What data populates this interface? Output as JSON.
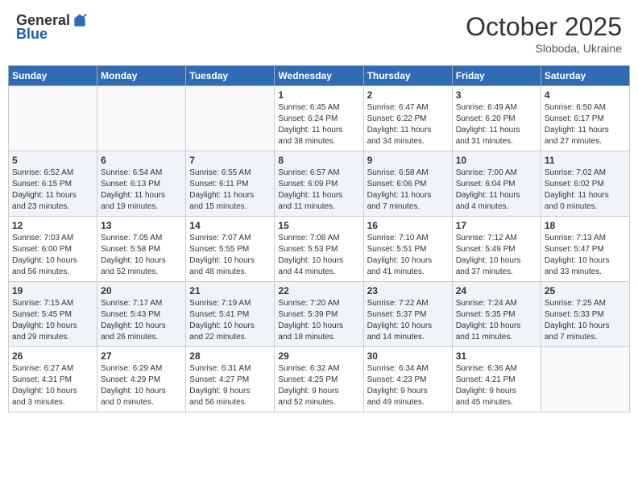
{
  "header": {
    "logo_general": "General",
    "logo_blue": "Blue",
    "month_year": "October 2025",
    "location": "Sloboda, Ukraine"
  },
  "weekdays": [
    "Sunday",
    "Monday",
    "Tuesday",
    "Wednesday",
    "Thursday",
    "Friday",
    "Saturday"
  ],
  "weeks": [
    [
      {
        "day": "",
        "info": ""
      },
      {
        "day": "",
        "info": ""
      },
      {
        "day": "",
        "info": ""
      },
      {
        "day": "1",
        "info": "Sunrise: 6:45 AM\nSunset: 6:24 PM\nDaylight: 11 hours\nand 38 minutes."
      },
      {
        "day": "2",
        "info": "Sunrise: 6:47 AM\nSunset: 6:22 PM\nDaylight: 11 hours\nand 34 minutes."
      },
      {
        "day": "3",
        "info": "Sunrise: 6:49 AM\nSunset: 6:20 PM\nDaylight: 11 hours\nand 31 minutes."
      },
      {
        "day": "4",
        "info": "Sunrise: 6:50 AM\nSunset: 6:17 PM\nDaylight: 11 hours\nand 27 minutes."
      }
    ],
    [
      {
        "day": "5",
        "info": "Sunrise: 6:52 AM\nSunset: 6:15 PM\nDaylight: 11 hours\nand 23 minutes."
      },
      {
        "day": "6",
        "info": "Sunrise: 6:54 AM\nSunset: 6:13 PM\nDaylight: 11 hours\nand 19 minutes."
      },
      {
        "day": "7",
        "info": "Sunrise: 6:55 AM\nSunset: 6:11 PM\nDaylight: 11 hours\nand 15 minutes."
      },
      {
        "day": "8",
        "info": "Sunrise: 6:57 AM\nSunset: 6:09 PM\nDaylight: 11 hours\nand 11 minutes."
      },
      {
        "day": "9",
        "info": "Sunrise: 6:58 AM\nSunset: 6:06 PM\nDaylight: 11 hours\nand 7 minutes."
      },
      {
        "day": "10",
        "info": "Sunrise: 7:00 AM\nSunset: 6:04 PM\nDaylight: 11 hours\nand 4 minutes."
      },
      {
        "day": "11",
        "info": "Sunrise: 7:02 AM\nSunset: 6:02 PM\nDaylight: 11 hours\nand 0 minutes."
      }
    ],
    [
      {
        "day": "12",
        "info": "Sunrise: 7:03 AM\nSunset: 6:00 PM\nDaylight: 10 hours\nand 56 minutes."
      },
      {
        "day": "13",
        "info": "Sunrise: 7:05 AM\nSunset: 5:58 PM\nDaylight: 10 hours\nand 52 minutes."
      },
      {
        "day": "14",
        "info": "Sunrise: 7:07 AM\nSunset: 5:55 PM\nDaylight: 10 hours\nand 48 minutes."
      },
      {
        "day": "15",
        "info": "Sunrise: 7:08 AM\nSunset: 5:53 PM\nDaylight: 10 hours\nand 44 minutes."
      },
      {
        "day": "16",
        "info": "Sunrise: 7:10 AM\nSunset: 5:51 PM\nDaylight: 10 hours\nand 41 minutes."
      },
      {
        "day": "17",
        "info": "Sunrise: 7:12 AM\nSunset: 5:49 PM\nDaylight: 10 hours\nand 37 minutes."
      },
      {
        "day": "18",
        "info": "Sunrise: 7:13 AM\nSunset: 5:47 PM\nDaylight: 10 hours\nand 33 minutes."
      }
    ],
    [
      {
        "day": "19",
        "info": "Sunrise: 7:15 AM\nSunset: 5:45 PM\nDaylight: 10 hours\nand 29 minutes."
      },
      {
        "day": "20",
        "info": "Sunrise: 7:17 AM\nSunset: 5:43 PM\nDaylight: 10 hours\nand 26 minutes."
      },
      {
        "day": "21",
        "info": "Sunrise: 7:19 AM\nSunset: 5:41 PM\nDaylight: 10 hours\nand 22 minutes."
      },
      {
        "day": "22",
        "info": "Sunrise: 7:20 AM\nSunset: 5:39 PM\nDaylight: 10 hours\nand 18 minutes."
      },
      {
        "day": "23",
        "info": "Sunrise: 7:22 AM\nSunset: 5:37 PM\nDaylight: 10 hours\nand 14 minutes."
      },
      {
        "day": "24",
        "info": "Sunrise: 7:24 AM\nSunset: 5:35 PM\nDaylight: 10 hours\nand 11 minutes."
      },
      {
        "day": "25",
        "info": "Sunrise: 7:25 AM\nSunset: 5:33 PM\nDaylight: 10 hours\nand 7 minutes."
      }
    ],
    [
      {
        "day": "26",
        "info": "Sunrise: 6:27 AM\nSunset: 4:31 PM\nDaylight: 10 hours\nand 3 minutes."
      },
      {
        "day": "27",
        "info": "Sunrise: 6:29 AM\nSunset: 4:29 PM\nDaylight: 10 hours\nand 0 minutes."
      },
      {
        "day": "28",
        "info": "Sunrise: 6:31 AM\nSunset: 4:27 PM\nDaylight: 9 hours\nand 56 minutes."
      },
      {
        "day": "29",
        "info": "Sunrise: 6:32 AM\nSunset: 4:25 PM\nDaylight: 9 hours\nand 52 minutes."
      },
      {
        "day": "30",
        "info": "Sunrise: 6:34 AM\nSunset: 4:23 PM\nDaylight: 9 hours\nand 49 minutes."
      },
      {
        "day": "31",
        "info": "Sunrise: 6:36 AM\nSunset: 4:21 PM\nDaylight: 9 hours\nand 45 minutes."
      },
      {
        "day": "",
        "info": ""
      }
    ]
  ]
}
